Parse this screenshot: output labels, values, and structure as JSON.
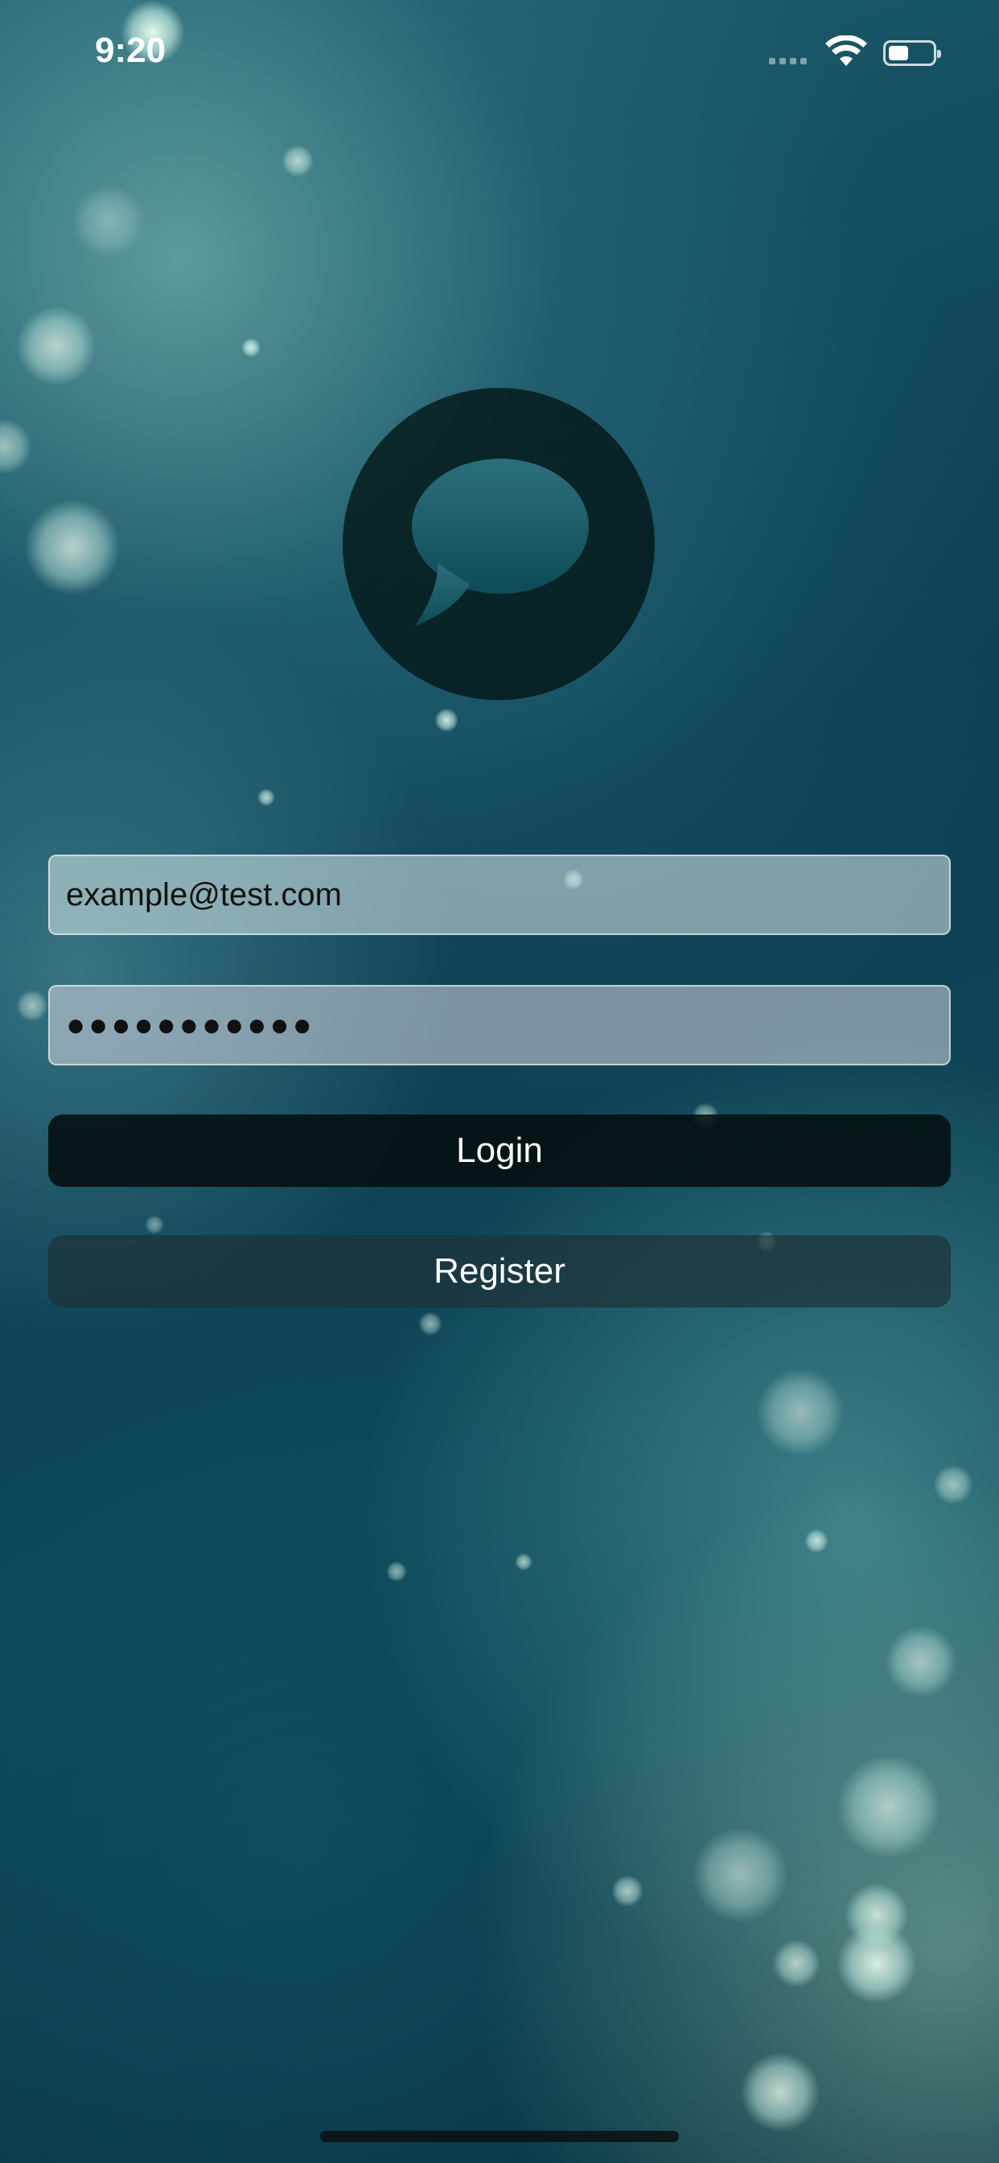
{
  "status_bar": {
    "time": "9:20"
  },
  "icons": {
    "logo": "chat-bubble-icon",
    "wifi": "wifi-icon",
    "battery": "battery-icon",
    "signal": "signal-icon"
  },
  "login_form": {
    "email_value": "example@test.com",
    "password_value": "●●●●●●●●●●●",
    "login_label": "Login",
    "register_label": "Register"
  },
  "colors": {
    "background_teal": "#0c3f52",
    "button_dark": "#050f0f"
  }
}
